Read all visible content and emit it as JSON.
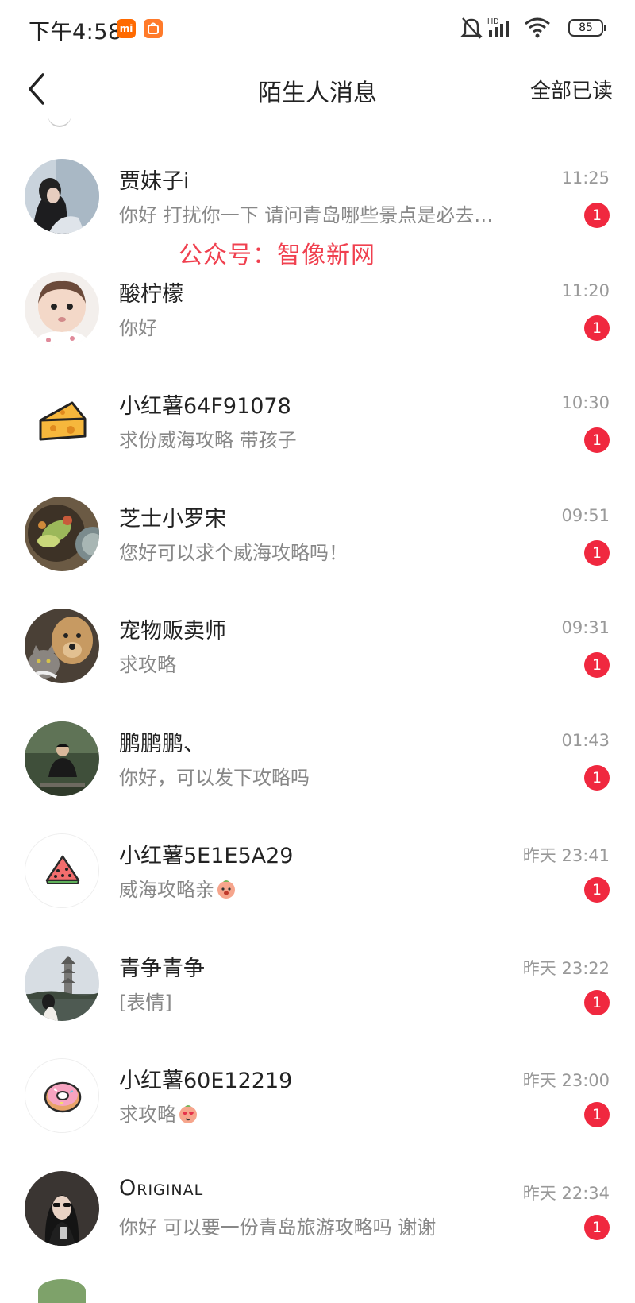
{
  "status_bar": {
    "time": "下午4:58",
    "signal": "HD",
    "battery": "85",
    "icons": [
      "mi-app-icon",
      "mi-store-icon",
      "mute-bell-icon",
      "signal-icon",
      "wifi-icon",
      "battery-icon"
    ]
  },
  "header": {
    "back_icon": "chevron-left-icon",
    "title": "陌生人消息",
    "mark_all_read": "全部已读"
  },
  "watermark": "公众号：智像新网",
  "colors": {
    "badge": "#f0283f",
    "watermark": "#f0404f",
    "secondary_text": "#888888",
    "time_text": "#999999"
  },
  "messages": [
    {
      "name": "贾妹子i",
      "time": "11:25",
      "preview": "你好 打扰你一下 请问青岛哪些景点是必去…",
      "unread": "1",
      "avatar": "photo-girl-avatar"
    },
    {
      "name": "酸柠檬",
      "time": "11:20",
      "preview": "你好",
      "unread": "1",
      "avatar": "photo-baby-avatar"
    },
    {
      "name": "小红薯64F91078",
      "time": "10:30",
      "preview": "求份威海攻略 带孩子",
      "unread": "1",
      "avatar": "cheese-avatar"
    },
    {
      "name": "芝士小罗宋",
      "time": "09:51",
      "preview": "您好可以求个威海攻略吗！",
      "unread": "1",
      "avatar": "photo-food-avatar"
    },
    {
      "name": "宠物贩卖师",
      "time": "09:31",
      "preview": "求攻略",
      "unread": "1",
      "avatar": "photo-pets-avatar"
    },
    {
      "name": "鹏鹏鹏、",
      "time": "01:43",
      "preview": "你好，可以发下攻略吗",
      "unread": "1",
      "avatar": "photo-man-avatar"
    },
    {
      "name": "小红薯5E1E5A29",
      "time": "昨天 23:41",
      "preview": "威海攻略亲",
      "emoji": "peach-face-emoji",
      "unread": "1",
      "avatar": "watermelon-avatar"
    },
    {
      "name": "青争青争",
      "time": "昨天 23:22",
      "preview": "[表情]",
      "unread": "1",
      "avatar": "photo-pagoda-avatar"
    },
    {
      "name": "小红薯60E12219",
      "time": "昨天 23:00",
      "preview": "求攻略",
      "emoji": "heart-eyes-peach-emoji",
      "unread": "1",
      "avatar": "donut-avatar"
    },
    {
      "name": "Original",
      "time": "昨天 22:34",
      "preview": "你好 可以要一份青岛旅游攻略吗 谢谢",
      "unread": "1",
      "avatar": "photo-woman-avatar"
    }
  ]
}
